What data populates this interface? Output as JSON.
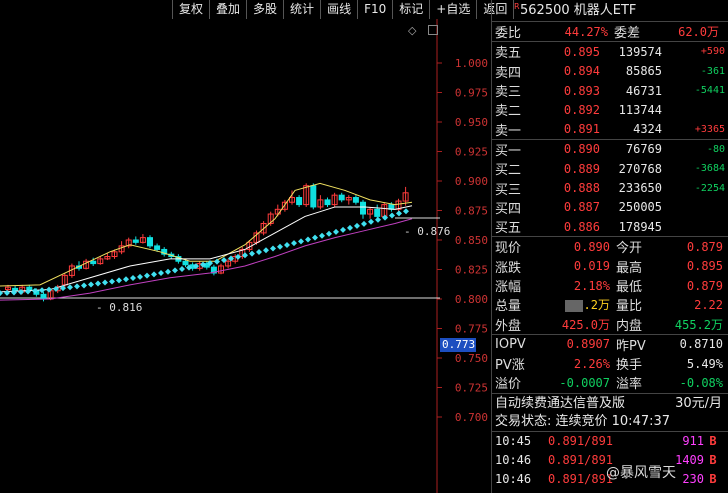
{
  "toolbar": {
    "buttons": [
      "复权",
      "叠加",
      "多股",
      "统计",
      "画线",
      "F10",
      "标记",
      "+自选",
      "返回"
    ]
  },
  "chart": {
    "price_axis": [
      "1.000",
      "0.975",
      "0.950",
      "0.925",
      "0.900",
      "0.875",
      "0.850",
      "0.825",
      "0.800",
      "0.775",
      "0.750",
      "0.725",
      "0.700"
    ],
    "high_label": "0.876",
    "low_label": "0.816",
    "cursor_price": "0.773",
    "colors": {
      "up": "#ff3c3c",
      "down": "#10e0e0",
      "ma_white": "#ffffff",
      "ma_yellow": "#f0e060",
      "ma_purple": "#c040c0",
      "ma_dots": "#40e0f0"
    }
  },
  "header": {
    "r_mark": "R",
    "code": "562500",
    "name": "机器人ETF"
  },
  "weibi": {
    "label": "委比",
    "value": "44.27%",
    "label2": "委差",
    "value2": "62.0万"
  },
  "asks": [
    {
      "label": "卖五",
      "price": "0.895",
      "vol": "139574",
      "chg": "+590"
    },
    {
      "label": "卖四",
      "price": "0.894",
      "vol": "85865",
      "chg": "-361"
    },
    {
      "label": "卖三",
      "price": "0.893",
      "vol": "46731",
      "chg": "-5441"
    },
    {
      "label": "卖二",
      "price": "0.892",
      "vol": "113744",
      "chg": ""
    },
    {
      "label": "卖一",
      "price": "0.891",
      "vol": "4324",
      "chg": "+3365"
    }
  ],
  "bids": [
    {
      "label": "买一",
      "price": "0.890",
      "vol": "76769",
      "chg": "-80"
    },
    {
      "label": "买二",
      "price": "0.889",
      "vol": "270768",
      "chg": "-3684"
    },
    {
      "label": "买三",
      "price": "0.888",
      "vol": "233650",
      "chg": "-2254"
    },
    {
      "label": "买四",
      "price": "0.887",
      "vol": "250005",
      "chg": ""
    },
    {
      "label": "买五",
      "price": "0.886",
      "vol": "178945",
      "chg": ""
    }
  ],
  "quote": {
    "xianjia_label": "现价",
    "xianjia": "0.890",
    "jinkai_label": "今开",
    "jinkai": "0.879",
    "zhangdie_label": "涨跌",
    "zhangdie": "0.019",
    "zuigao_label": "最高",
    "zuigao": "0.895",
    "zhangfu_label": "涨幅",
    "zhangfu": "2.18%",
    "zuidi_label": "最低",
    "zuidi": "0.879",
    "zongliang_label": "总量",
    "zongliang": ".2万",
    "liangbi_label": "量比",
    "liangbi": "2.22",
    "waipan_label": "外盘",
    "waipan": "425.0万",
    "neipan_label": "内盘",
    "neipan": "455.2万"
  },
  "iopv": {
    "iopv_label": "IOPV",
    "iopv": "0.8907",
    "zuopv_label": "昨PV",
    "zuopv": "0.8710",
    "pvzhang_label": "PV涨",
    "pvzhang": "2.26%",
    "huanshou_label": "换手",
    "huanshou": "5.49%",
    "yijia_label": "溢价",
    "yijia": "-0.0007",
    "yijialv_label": "溢率",
    "yijialv": "-0.08%"
  },
  "fee": {
    "text": "自动续费通达信普及版",
    "price": "30元/月"
  },
  "status": {
    "text": "交易状态: 连续竞价 10:47:37"
  },
  "ticks": [
    {
      "time": "10:45",
      "price": "0.891/891",
      "vol": "911",
      "side": "B"
    },
    {
      "time": "10:46",
      "price": "0.891/891",
      "vol": "1409",
      "side": "B"
    },
    {
      "time": "10:46",
      "price": "0.891/891",
      "vol": "230",
      "side": "B"
    }
  ],
  "watermark": "@暴风雪天"
}
